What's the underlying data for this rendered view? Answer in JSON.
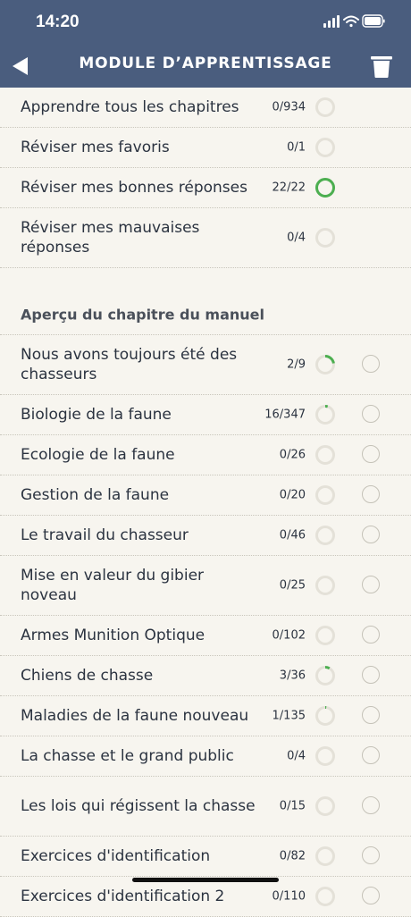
{
  "status": {
    "time": "14:20"
  },
  "nav": {
    "title": "MODULE D’APPRENTISSAGE",
    "back_icon": "back-arrow-icon",
    "trash_icon": "trash-icon"
  },
  "colors": {
    "header": "#4a5d7e",
    "progress": "#4caf50",
    "background": "#f7f5ef"
  },
  "top_items": [
    {
      "label": "Apprendre tous les chapitres",
      "count": "0/934",
      "progress": 0
    },
    {
      "label": "Réviser mes favoris",
      "count": "0/1",
      "progress": 0
    },
    {
      "label": "Réviser mes bonnes réponses",
      "count": "22/22",
      "progress": 1
    },
    {
      "label": "Réviser mes mauvaises réponses",
      "count": "0/4",
      "progress": 0
    }
  ],
  "section_title": "Aperçu du chapitre du manuel",
  "chapters": [
    {
      "label": "Nous avons toujours été des chasseurs",
      "count": "2/9",
      "progress": 0.222
    },
    {
      "label": "Biologie de la faune",
      "count": "16/347",
      "progress": 0.046
    },
    {
      "label": "Ecologie de la faune",
      "count": "0/26",
      "progress": 0
    },
    {
      "label": "Gestion de la faune",
      "count": "0/20",
      "progress": 0
    },
    {
      "label": "Le travail du chasseur",
      "count": "0/46",
      "progress": 0
    },
    {
      "label": "Mise en valeur du gibier noveau",
      "count": "0/25",
      "progress": 0
    },
    {
      "label": "Armes Munition Optique",
      "count": "0/102",
      "progress": 0
    },
    {
      "label": "Chiens de chasse",
      "count": "3/36",
      "progress": 0.083
    },
    {
      "label": "Maladies de la faune nouveau",
      "count": "1/135",
      "progress": 0.007
    },
    {
      "label": "La chasse et le grand public",
      "count": "0/4",
      "progress": 0
    },
    {
      "label": "Les lois qui régissent la chasse",
      "count": "0/15",
      "progress": 0
    },
    {
      "label": "Exercices d'identification",
      "count": "0/82",
      "progress": 0
    },
    {
      "label": "Exercices d'identification 2",
      "count": "0/110",
      "progress": 0
    }
  ]
}
